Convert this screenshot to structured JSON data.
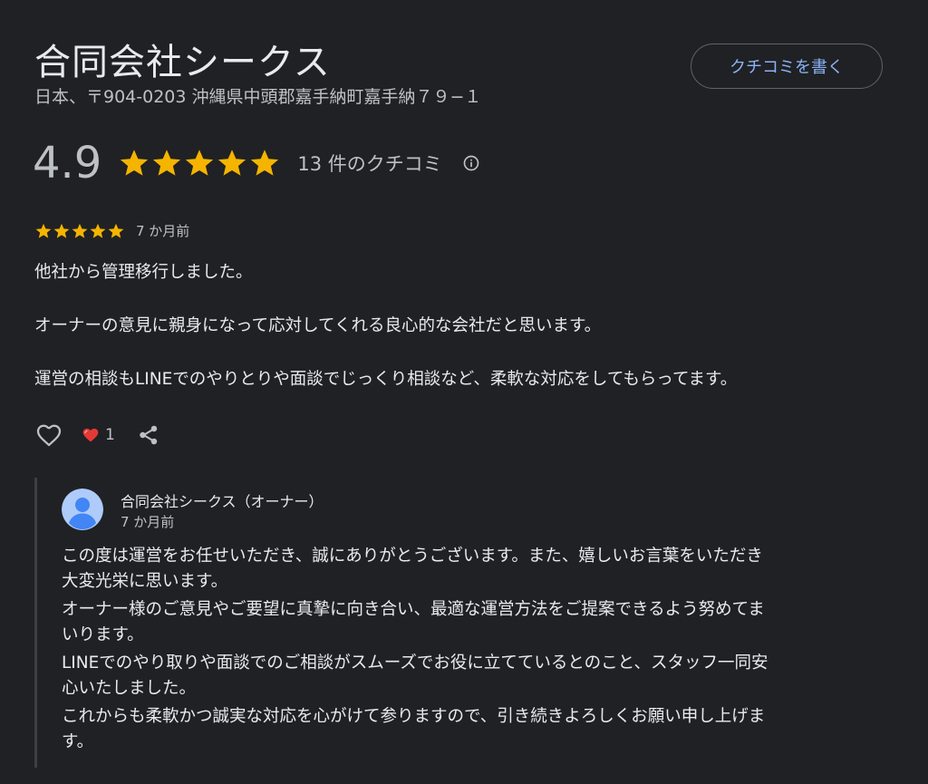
{
  "business": {
    "name": "合同会社シークス",
    "address": "日本、〒904-0203 沖縄県中頭郡嘉手納町嘉手納７９−１"
  },
  "write_review_label": "クチコミを書く",
  "summary": {
    "rating": "4.9",
    "stars": 5,
    "review_count_label": "13 件のクチコミ",
    "star_color": "#f4b400"
  },
  "review": {
    "stars": 5,
    "time": "7 か月前",
    "paragraphs": [
      "他社から管理移行しました。",
      "オーナーの意見に親身になって応対してくれる良心的な会社だと思います。",
      "運営の相談もLINEでのやりとりや面談でじっくり相談など、柔軟な対応をしてもらってます。"
    ],
    "reaction_count": "1",
    "icons": {
      "like": "heart-outline-icon",
      "reaction": "red-heart-icon",
      "share": "share-icon",
      "info": "info-icon"
    }
  },
  "owner_reply": {
    "name": "合同会社シークス（オーナー）",
    "time": "7 か月前",
    "lines": [
      "この度は運営をお任せいただき、誠にありがとうございます。また、嬉しいお言葉をいただき",
      "大変光栄に思います。",
      "オーナー様のご意見やご要望に真摯に向き合い、最適な運営方法をご提案できるよう努めてま",
      "いります。",
      "LINEでのやり取りや面談でのご相談がスムーズでお役に立てているとのこと、スタッフ一同安",
      "心いたしました。",
      "これからも柔軟かつ誠実な対応を心がけて参りますので、引き続きよろしくお願い申し上げま",
      "す。"
    ]
  },
  "colors": {
    "background": "#202124",
    "accent": "#8ab4f8",
    "text": "#e8eaed",
    "secondary_text": "#bdc1c6"
  }
}
